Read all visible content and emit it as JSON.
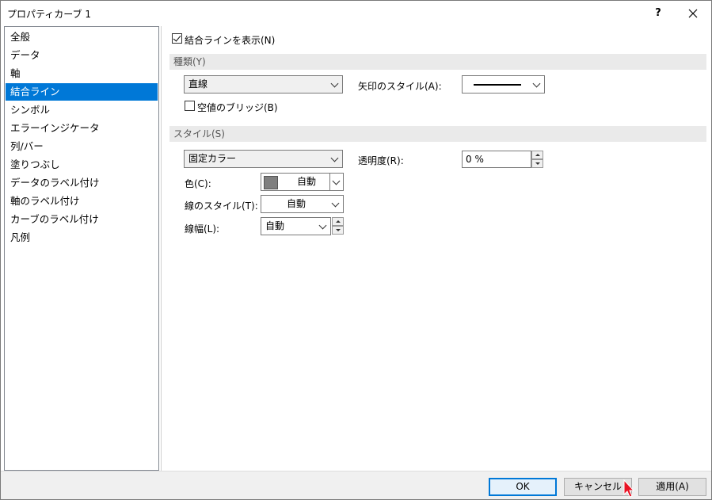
{
  "window": {
    "title": "プロパティカーブ 1",
    "help": "?",
    "close": "✕"
  },
  "sidebar": {
    "items": [
      {
        "label": "全般",
        "selected": false
      },
      {
        "label": "データ",
        "selected": false
      },
      {
        "label": "軸",
        "selected": false
      },
      {
        "label": "結合ライン",
        "selected": true
      },
      {
        "label": "シンボル",
        "selected": false
      },
      {
        "label": "エラーインジケータ",
        "selected": false
      },
      {
        "label": "列/バー",
        "selected": false
      },
      {
        "label": "塗りつぶし",
        "selected": false
      },
      {
        "label": "データのラベル付け",
        "selected": false
      },
      {
        "label": "軸のラベル付け",
        "selected": false
      },
      {
        "label": "カーブのラベル付け",
        "selected": false
      },
      {
        "label": "凡例",
        "selected": false
      }
    ]
  },
  "content": {
    "show_line": {
      "label": "結合ラインを表示(N)",
      "checked": true
    },
    "type_section": "種類(Y)",
    "type_combo": "直線",
    "arrow_style_label": "矢印のスタイル(A):",
    "zero_bridge": {
      "label": "空値のブリッジ(B)",
      "checked": false
    },
    "style_section": "スタイル(S)",
    "style_combo": "固定カラー",
    "transparency_label": "透明度(R):",
    "transparency_value": "0 %",
    "color_label": "色(C):",
    "color_value": "自動",
    "color_swatch": "#7f7f7f",
    "line_style_label": "線のスタイル(T):",
    "line_style_value": "自動",
    "line_width_label": "線幅(L):",
    "line_width_value": "自動"
  },
  "footer": {
    "ok": "OK",
    "cancel": "キャンセル",
    "apply": "適用(A)"
  },
  "colors": {
    "accent": "#0078d7",
    "cursor": "#e81123"
  }
}
